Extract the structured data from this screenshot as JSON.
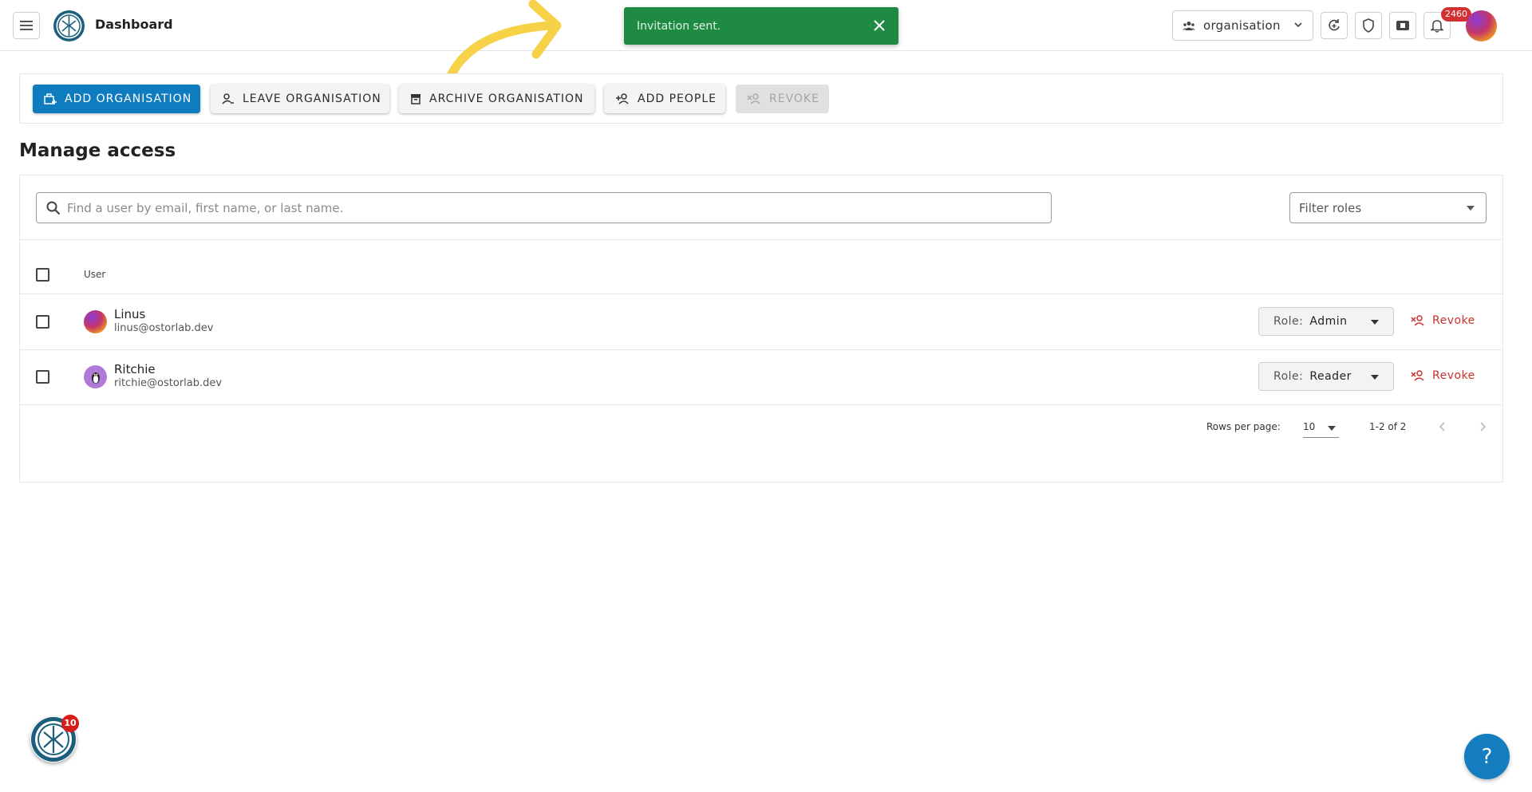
{
  "header": {
    "title": "Dashboard",
    "org_select": {
      "label": "organisation"
    },
    "notification_count": "2460"
  },
  "toast": {
    "message": "Invitation sent."
  },
  "actions": {
    "add_organisation": "ADD ORGANISATION",
    "leave_organisation": "LEAVE ORGANISATION",
    "archive_organisation": "ARCHIVE ORGANISATION",
    "add_people": "ADD PEOPLE",
    "revoke": "REVOKE"
  },
  "section": {
    "title": "Manage access"
  },
  "search": {
    "placeholder": "Find a user by email, first name, or last name.",
    "value": ""
  },
  "filter_roles": {
    "placeholder": "Filter roles"
  },
  "table": {
    "columns": [
      "User"
    ],
    "rows": [
      {
        "name": "Linus",
        "email": "linus@ostorlab.dev",
        "role_label": "Role:",
        "role": "Admin",
        "action": "Revoke"
      },
      {
        "name": "Ritchie",
        "email": "ritchie@ostorlab.dev",
        "role_label": "Role:",
        "role": "Reader",
        "action": "Revoke"
      }
    ]
  },
  "pagination": {
    "rows_per_page_label": "Rows per page:",
    "rows_per_page": "10",
    "range": "1-2 of 2"
  },
  "widget": {
    "badge_count": "10"
  },
  "help": {
    "label": "?"
  },
  "colors": {
    "primary": "#0f7cbf",
    "toast_bg": "#1e8a43",
    "revoke": "#c9302c",
    "badge": "#d33131"
  }
}
